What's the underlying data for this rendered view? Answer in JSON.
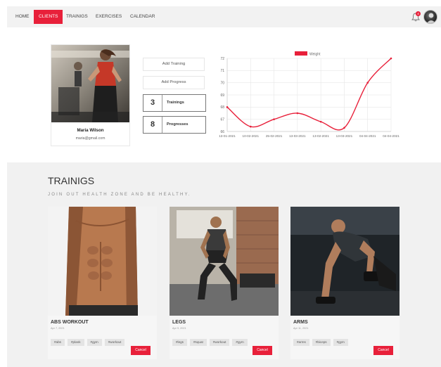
{
  "nav": {
    "items": [
      {
        "label": "HOME"
      },
      {
        "label": "CLIENTS"
      },
      {
        "label": "TRAINIGS"
      },
      {
        "label": "EXERCISES"
      },
      {
        "label": "CALENDAR"
      }
    ],
    "active_index": 1,
    "notification_count": "4"
  },
  "profile": {
    "name": "Maria  Wilson",
    "email": "maria@gmail.com"
  },
  "actions": {
    "add_training": "Add Training",
    "add_progress": "Add Progress"
  },
  "stats": [
    {
      "value": "3",
      "label": "Trainings"
    },
    {
      "value": "8",
      "label": "Progresses"
    }
  ],
  "chart_data": {
    "type": "line",
    "legend": "Weight",
    "legend_color": "#e8203a",
    "x": [
      "13-01-2021",
      "10-02-2021",
      "25-02-2021",
      "13-03-2021",
      "13-02-2021",
      "13-03-2021",
      "04-04-2021",
      "04-04-2021"
    ],
    "y": [
      68,
      66.4,
      67,
      67.5,
      66.8,
      66.3,
      70,
      72
    ],
    "ylim": [
      66,
      72
    ],
    "yticks": [
      66,
      67,
      68,
      69,
      70,
      71,
      72
    ],
    "grid": true
  },
  "trainings": {
    "title": "TRAINIGS",
    "subtitle": "JOIN OUT HEALTH ZONE AND BE HEALTHY.",
    "cards": [
      {
        "title": "ABS WORKOUT",
        "date": "Apr 7, 2021",
        "tags": [
          "#abs",
          "#plank",
          "#gym",
          "#workout"
        ],
        "cancel": "Cancel"
      },
      {
        "title": "LEGS",
        "date": "Apr 9, 2021",
        "tags": [
          "#legs",
          "#squat",
          "#workout",
          "#gym"
        ],
        "cancel": "Cancel"
      },
      {
        "title": "ARMS",
        "date": "Apr 11, 2021",
        "tags": [
          "#arms",
          "#biceps",
          "#gym"
        ],
        "cancel": "Cancel"
      }
    ]
  },
  "colors": {
    "accent": "#e8203a",
    "band": "#f1f1f1"
  }
}
